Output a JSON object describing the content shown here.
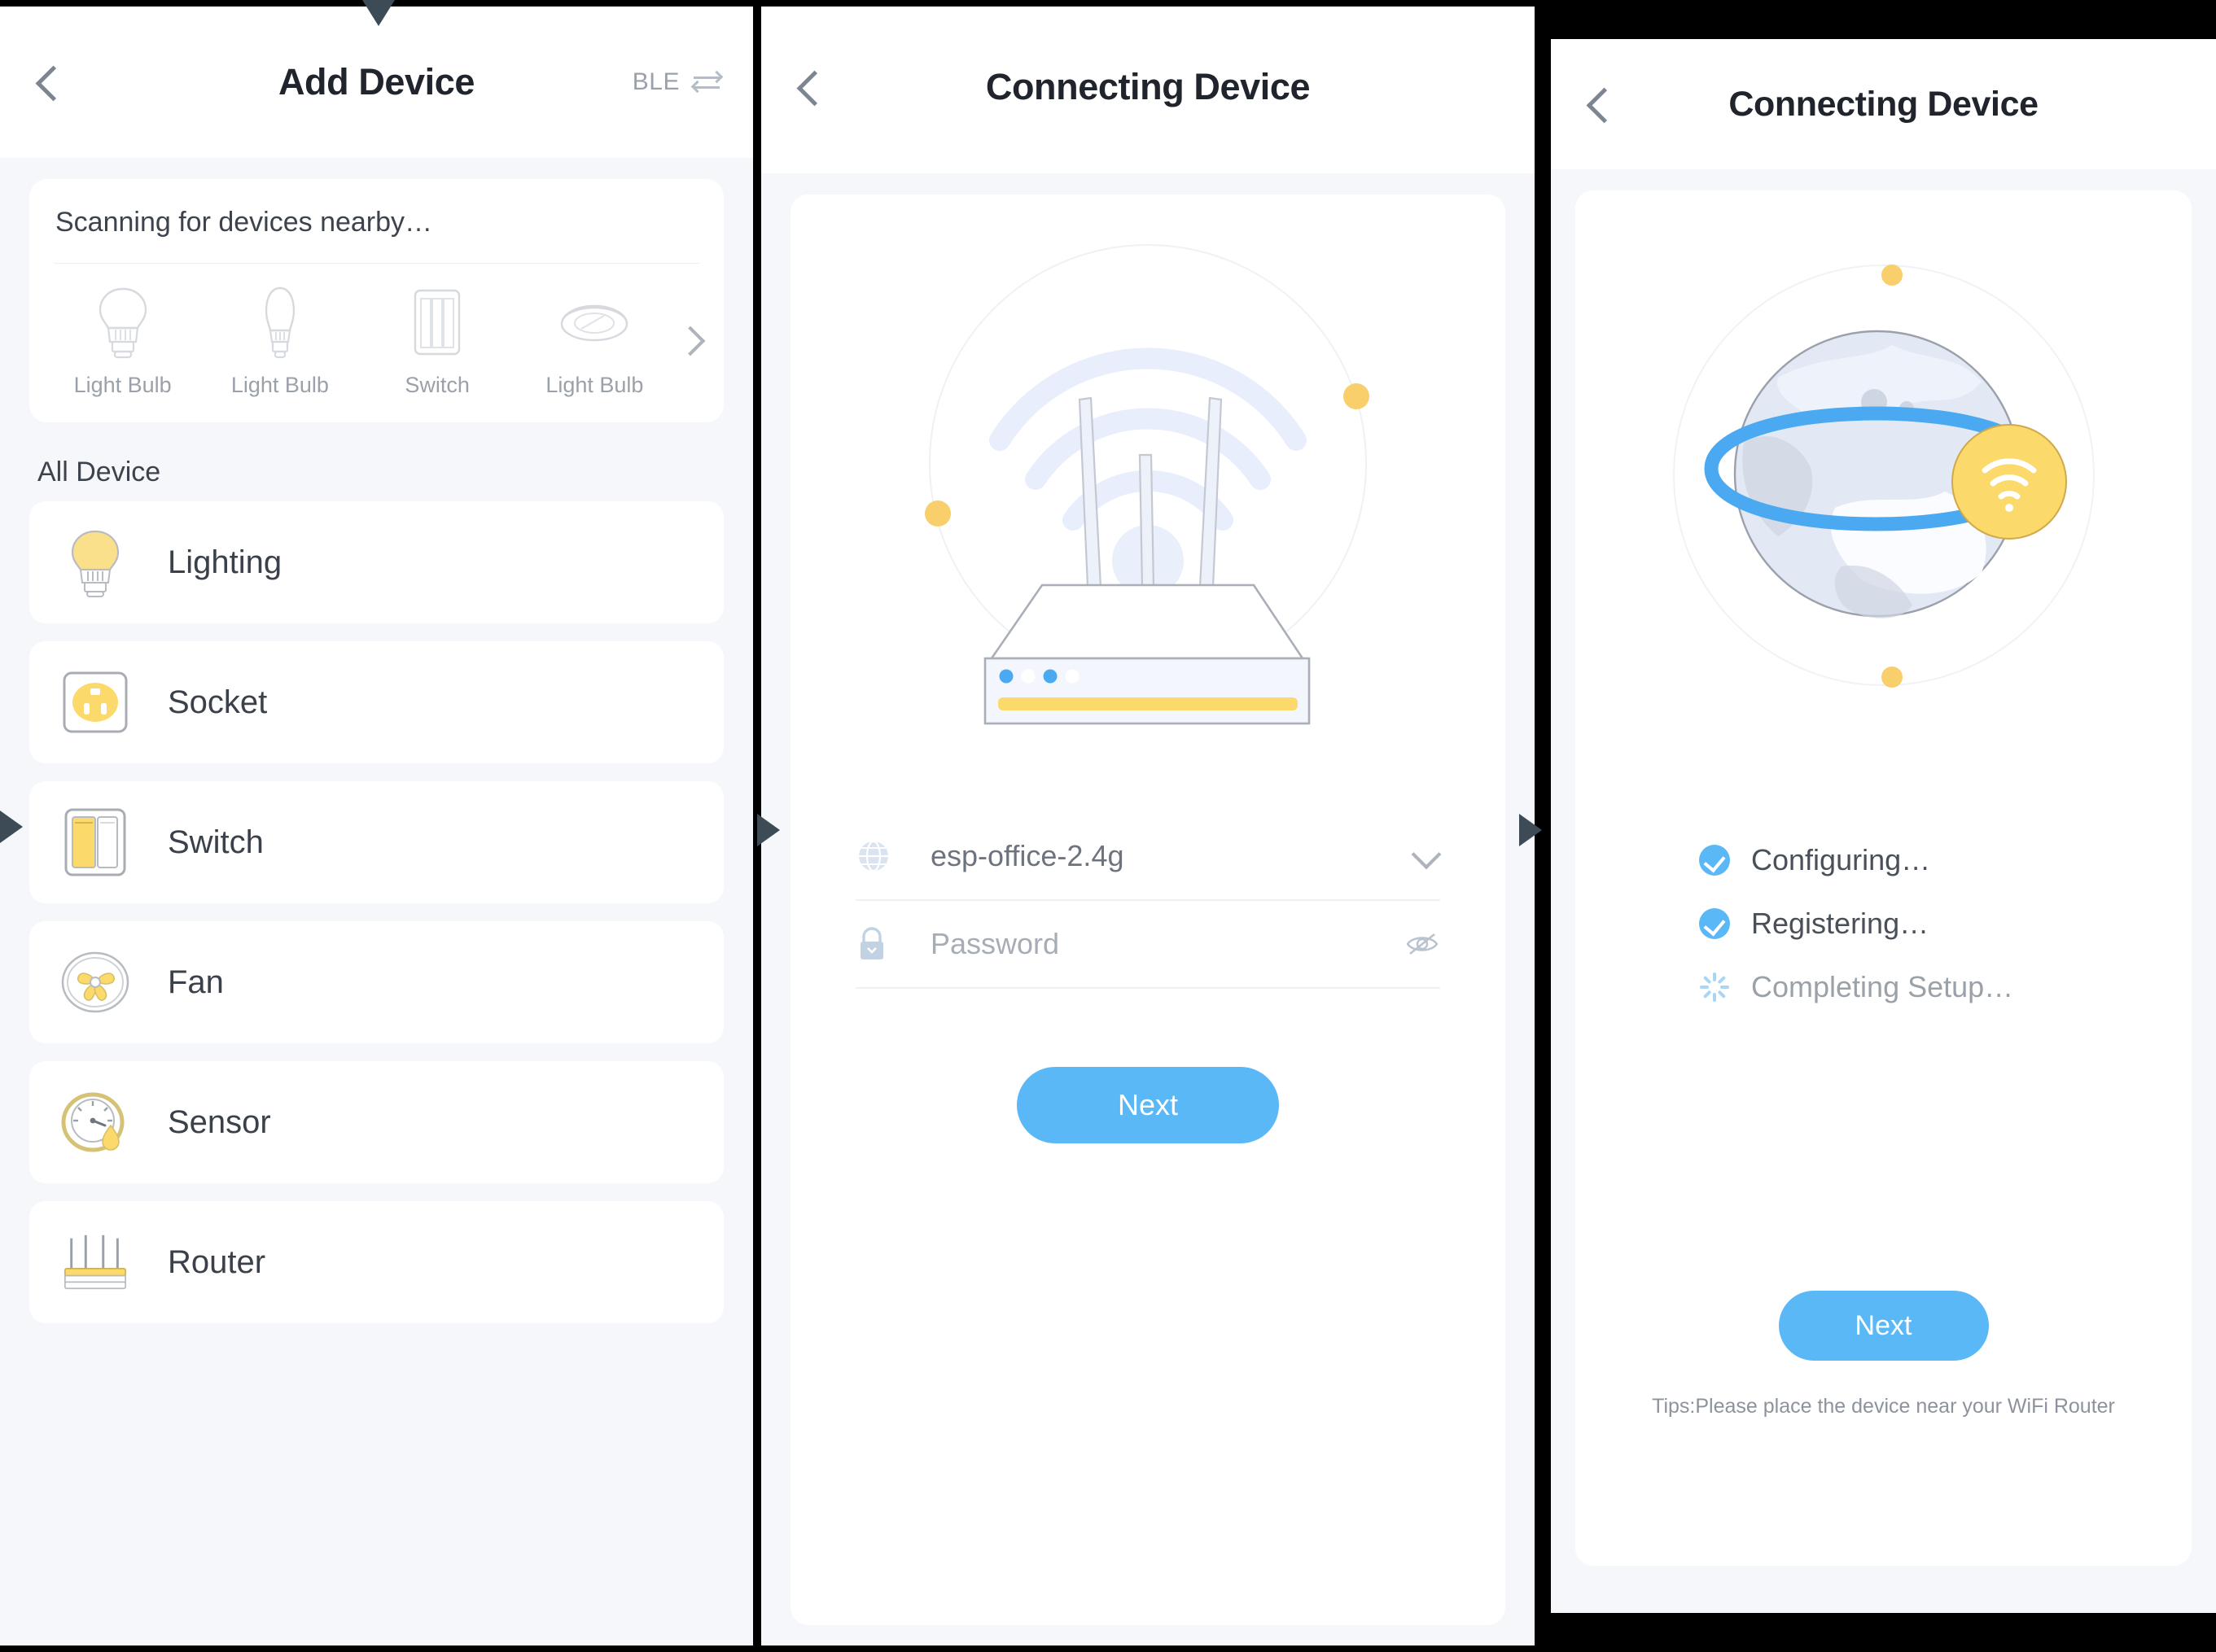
{
  "panels": [
    {
      "id": "add-device",
      "header": {
        "title": "Add Device",
        "ble_label": "BLE"
      },
      "scan": {
        "title": "Scanning for devices nearby…",
        "items": [
          {
            "label": "Light Bulb",
            "icon": "bulb-a19-icon"
          },
          {
            "label": "Light Bulb",
            "icon": "bulb-candle-icon"
          },
          {
            "label": "Switch",
            "icon": "switch-panel-icon"
          },
          {
            "label": "Light Bulb",
            "icon": "ceiling-light-icon"
          }
        ]
      },
      "all_device": {
        "section_label": "All Device",
        "items": [
          {
            "label": "Lighting",
            "icon": "lighting-bulb-icon"
          },
          {
            "label": "Socket",
            "icon": "socket-outlet-icon"
          },
          {
            "label": "Switch",
            "icon": "wall-switch-icon"
          },
          {
            "label": "Fan",
            "icon": "fan-icon"
          },
          {
            "label": "Sensor",
            "icon": "sensor-gauge-icon"
          },
          {
            "label": "Router",
            "icon": "router-icon"
          }
        ]
      }
    },
    {
      "id": "connecting-wifi",
      "header": {
        "title": "Connecting Device"
      },
      "form": {
        "ssid_value": "esp-office-2.4g",
        "password_placeholder": "Password",
        "ssid_icon": "globe-icon",
        "password_icon": "lock-icon",
        "dropdown_icon": "chevron-down-icon",
        "reveal_icon": "eye-slash-icon"
      },
      "next_label": "Next"
    },
    {
      "id": "connecting-progress",
      "header": {
        "title": "Connecting Device"
      },
      "status": [
        {
          "label": "Configuring…",
          "state": "done"
        },
        {
          "label": "Registering…",
          "state": "done"
        },
        {
          "label": "Completing Setup…",
          "state": "loading"
        }
      ],
      "next_label": "Next",
      "tips": "Tips:Please place the device near your WiFi Router"
    }
  ],
  "colors": {
    "accent_blue": "#5bb8f7",
    "accent_yellow": "#fad87e",
    "page_bg": "#f5f7fa",
    "card_bg": "#ffffff",
    "text_primary": "#3b414b",
    "text_muted": "#9ba1a9"
  }
}
